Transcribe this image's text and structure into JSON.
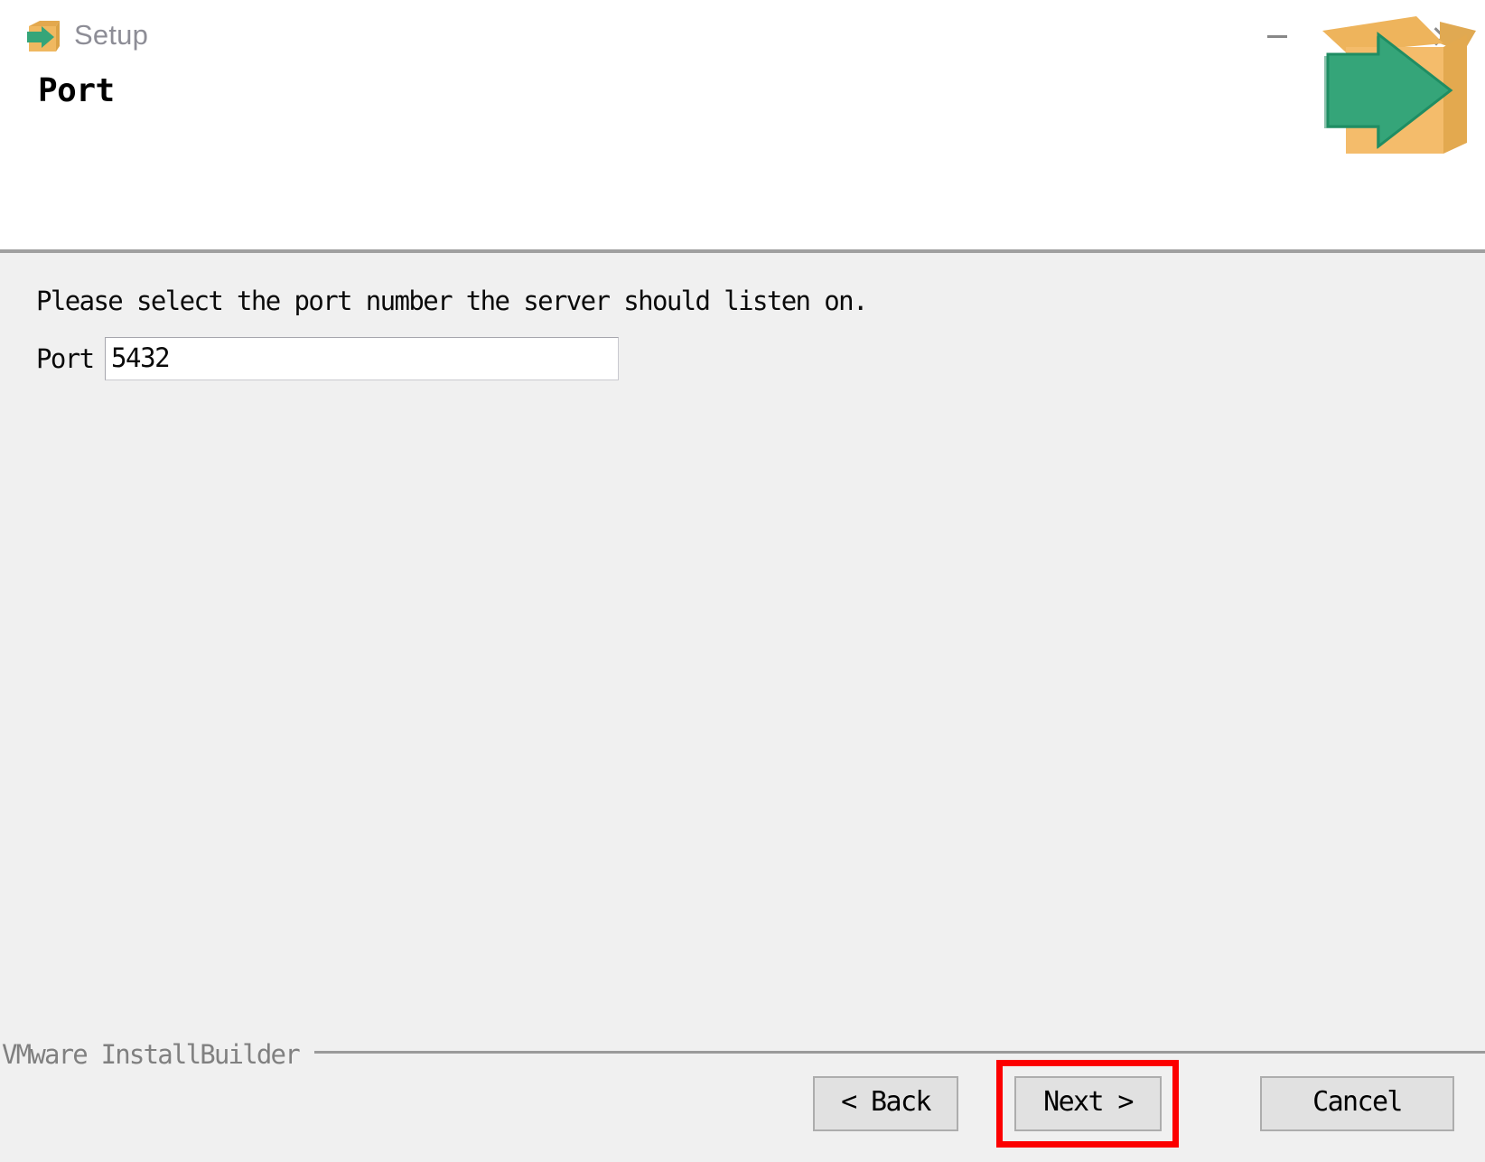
{
  "window": {
    "title": "Setup",
    "icon": "setup-box-arrow-icon",
    "controls": {
      "minimize": "minimize-icon",
      "maximize": "maximize-icon",
      "close": "close-icon"
    }
  },
  "header": {
    "page_title": "Port",
    "logo": "installbuilder-box-arrow-logo"
  },
  "main": {
    "instruction": "Please select the port number the server should listen on.",
    "port_field": {
      "label": "Port",
      "value": "5432",
      "placeholder": ""
    }
  },
  "footer": {
    "brand": "VMware InstallBuilder",
    "buttons": {
      "back": "< Back",
      "next": "Next >",
      "cancel": "Cancel"
    },
    "highlight": {
      "target": "next-button",
      "color": "#fc0000"
    }
  },
  "colors": {
    "titlebar_bg": "#ffffff",
    "body_bg": "#f0f0f0",
    "title_text": "#8d8d96",
    "rule": "#a0a0a0",
    "button_bg": "#e1e1e1",
    "button_border": "#adadad",
    "box_orange": "#f0b860",
    "arrow_green": "#35a579",
    "highlight_red": "#fc0000"
  }
}
